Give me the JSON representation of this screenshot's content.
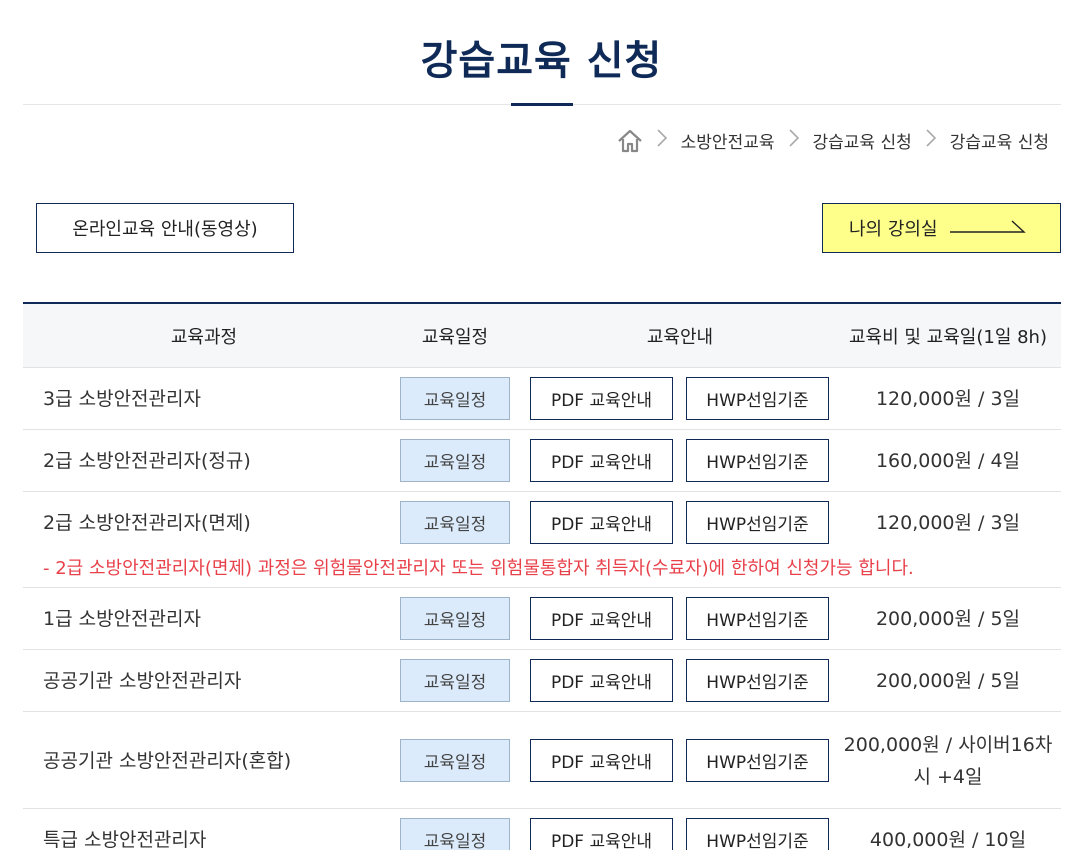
{
  "header": {
    "title": "강습교육 신청"
  },
  "breadcrumb": {
    "home_icon": "home-icon",
    "items": [
      "소방안전교육",
      "강습교육 신청",
      "강습교육 신청"
    ],
    "separator": ">"
  },
  "actions": {
    "guide_label": "온라인교육 안내(동영상)",
    "lecture_label": "나의 강의실",
    "lecture_icon": "arrow-right-icon",
    "lecture_color": "#fdff8a"
  },
  "table": {
    "headers": [
      "교육과정",
      "교육일정",
      "교육안내",
      "교육비 및 교육일(1일 8h)"
    ],
    "schedule_label": "교육일정",
    "pdf_label": "PDF 교육안내",
    "hwp_label": "HWP선임기준",
    "rows": [
      {
        "name": "3급 소방안전관리자",
        "fee": "120,000원 / 3일"
      },
      {
        "name": "2급 소방안전관리자(정규)",
        "fee": "160,000원 / 4일"
      },
      {
        "name": "2급 소방안전관리자(면제)",
        "fee": "120,000원 / 3일"
      },
      {
        "name": "1급 소방안전관리자",
        "fee": "200,000원 / 5일"
      },
      {
        "name": "공공기관 소방안전관리자",
        "fee": "200,000원 / 5일"
      },
      {
        "name": "공공기관 소방안전관리자(혼합)",
        "fee": "200,000원 / 사이버16차시 +4일"
      },
      {
        "name": "특급 소방안전관리자",
        "fee": "400,000원 / 10일"
      }
    ],
    "notice": "- 2급 소방안전관리자(면제) 과정은 위험물안전관리자 또는 위험물통합자 취득자(수료자)에 한하여 신청가능 합니다."
  },
  "colors": {
    "primary": "#0f2a56",
    "schedule_button": "#dcebfb",
    "notice": "#e8414a"
  }
}
